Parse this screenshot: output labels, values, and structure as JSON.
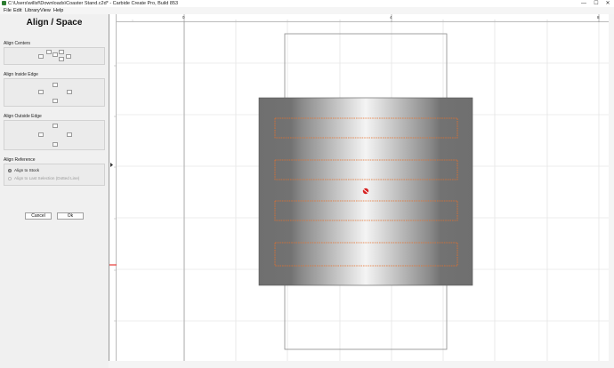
{
  "window": {
    "title": "C:\\Users\\willsf\\Downloads\\Coaster Stand.c2d* - Carbide Create Pro, Build 853",
    "minimize_glyph": "—",
    "maximize_glyph": "☐",
    "close_glyph": "✕"
  },
  "menu": {
    "file": "File",
    "edit": "Edit",
    "library": "Library",
    "view": "View",
    "help": "Help"
  },
  "panel": {
    "title": "Align / Space",
    "align_centers_label": "Align Centers",
    "align_inside_label": "Align Inside Edge",
    "align_outside_label": "Align Outside Edge",
    "align_reference_label": "Align Reference",
    "align_to_stock_label": "Align to Stock",
    "align_to_last_label": "Align to Last Selection (Dotted Line)",
    "align_to_stock_selected": true,
    "cancel_label": "Cancel",
    "ok_label": "Ok"
  },
  "ruler": {
    "x_labels": [
      "0",
      "4",
      "8"
    ]
  },
  "colors": {
    "toolpath": "#e8702a",
    "selection_marker": "#d62020",
    "stock_shade": "#777777",
    "grid": "#dddddd",
    "ruler_marker": "#e53935"
  }
}
